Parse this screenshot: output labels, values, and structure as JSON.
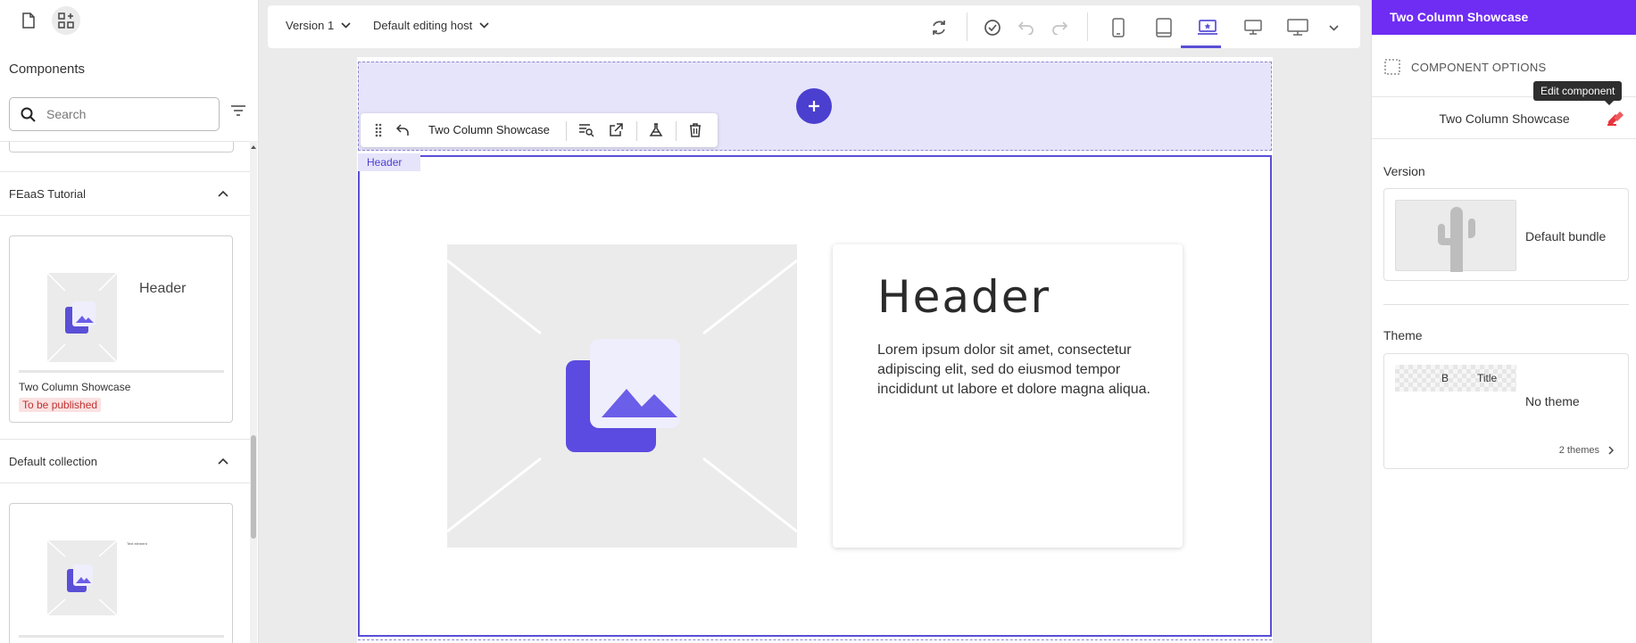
{
  "left": {
    "tabs": [
      {
        "icon": "page-icon"
      },
      {
        "icon": "components-icon"
      }
    ],
    "title": "Components",
    "search_placeholder": "Search",
    "sections": [
      {
        "title": "FEaaS Tutorial",
        "card": {
          "name": "Two Column Showcase",
          "status": "To be published",
          "thumb_header": "Header"
        }
      },
      {
        "title": "Default collection",
        "card": {
          "thumb_text": "Text element"
        }
      }
    ]
  },
  "toolbar": {
    "version": "Version 1",
    "host": "Default editing host",
    "icons": [
      "refresh-icon",
      "check-circle-icon",
      "undo-icon",
      "redo-icon",
      "mobile-icon",
      "tablet-icon",
      "laptop-icon",
      "desktop-icon",
      "wide-desktop-icon",
      "chevron-down-icon"
    ],
    "active_device": "laptop"
  },
  "canvas": {
    "chrome_title": "Two Column Showcase",
    "header_tag": "Header",
    "heading": "Header",
    "body": "Lorem ipsum dolor sit amet, consectetur adipiscing elit, sed do eiusmod tempor incididunt ut labore et dolore magna aliqua."
  },
  "right": {
    "title": "Two Column Showcase",
    "options_label": "COMPONENT OPTIONS",
    "tooltip": "Edit component",
    "component_name": "Two Column Showcase",
    "version_label": "Version",
    "bundle": "Default bundle",
    "theme_label": "Theme",
    "theme_preview_b": "B",
    "theme_preview_title": "Title",
    "theme_name": "No theme",
    "themes_count": "2 themes"
  },
  "colors": {
    "accent": "#5a4fd6",
    "header_bar": "#6f2cf3",
    "add_button": "#4b3fd0",
    "status_badge_bg": "#fbe1e1",
    "status_badge_text": "#c03232"
  }
}
